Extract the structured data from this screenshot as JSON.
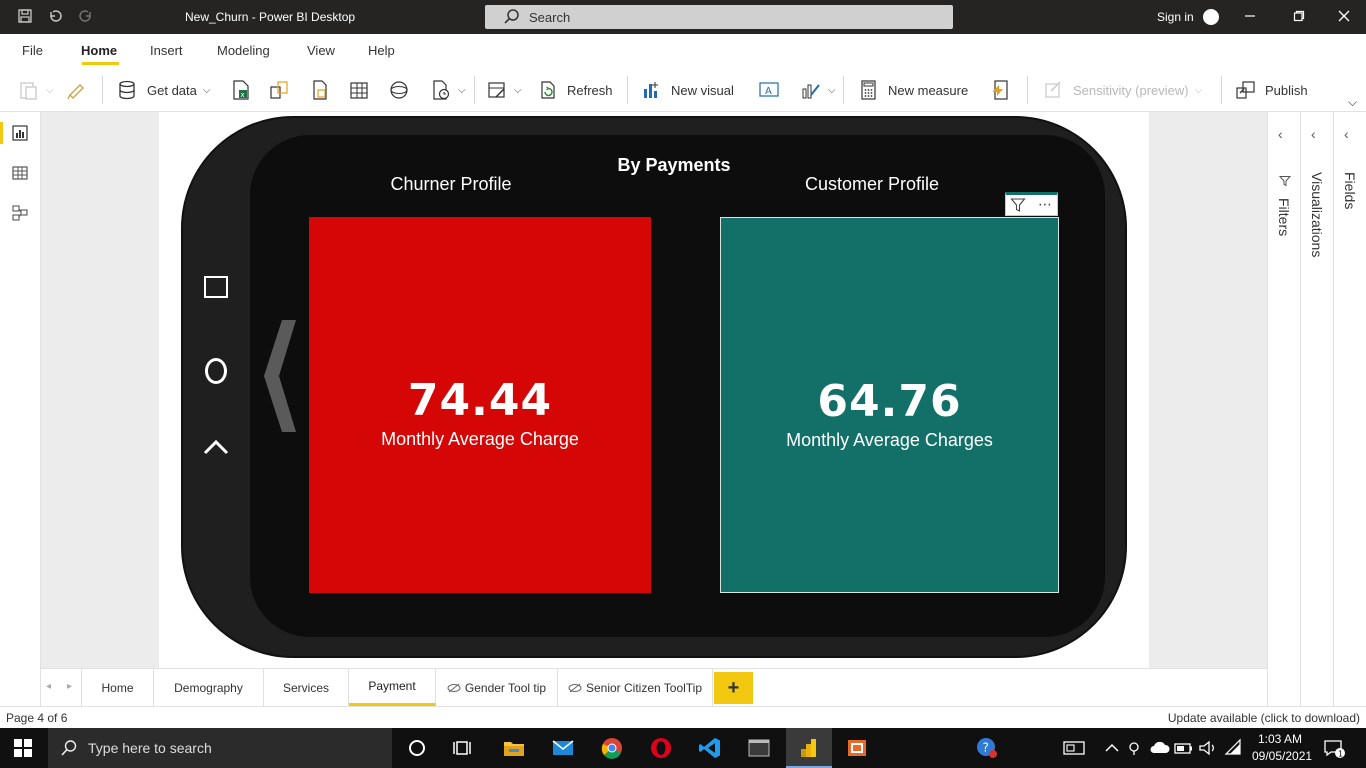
{
  "window": {
    "title": "New_Churn - Power BI Desktop",
    "search_label": "Search",
    "signin_label": "Sign in"
  },
  "menu": {
    "items": [
      "File",
      "Home",
      "Insert",
      "Modeling",
      "View",
      "Help"
    ],
    "active": "Home"
  },
  "ribbon": {
    "get_data": "Get data",
    "refresh": "Refresh",
    "new_visual": "New visual",
    "new_measure": "New measure",
    "sensitivity": "Sensitivity (preview)",
    "publish": "Publish"
  },
  "report": {
    "title": "By Payments",
    "left_heading": "Churner Profile",
    "right_heading": "Customer Profile",
    "cards": [
      {
        "value": "74.44",
        "label": "Monthly Average Charge",
        "color": "#d40606"
      },
      {
        "value": "64.76",
        "label": "Monthly Average Charges",
        "color": "#137068"
      }
    ]
  },
  "panes": {
    "filters": "Filters",
    "visualizations": "Visualizations",
    "fields": "Fields"
  },
  "page_tabs": [
    {
      "label": "Home",
      "hidden": false
    },
    {
      "label": "Demography",
      "hidden": false
    },
    {
      "label": "Services",
      "hidden": false
    },
    {
      "label": "Payment",
      "hidden": false,
      "active": true
    },
    {
      "label": "Gender Tool tip",
      "hidden": true
    },
    {
      "label": "Senior Citizen ToolTip",
      "hidden": true
    }
  ],
  "add_page_label": "+",
  "status": {
    "page_indicator": "Page 4 of 6",
    "update_text": "Update available (click to download)"
  },
  "taskbar": {
    "search_placeholder": "Type here to search",
    "time": "1:03 AM",
    "date": "09/05/2021"
  },
  "colors": {
    "accent": "#f2c811",
    "title_bar": "#252423",
    "churner_card": "#d40606",
    "customer_card": "#137068"
  }
}
